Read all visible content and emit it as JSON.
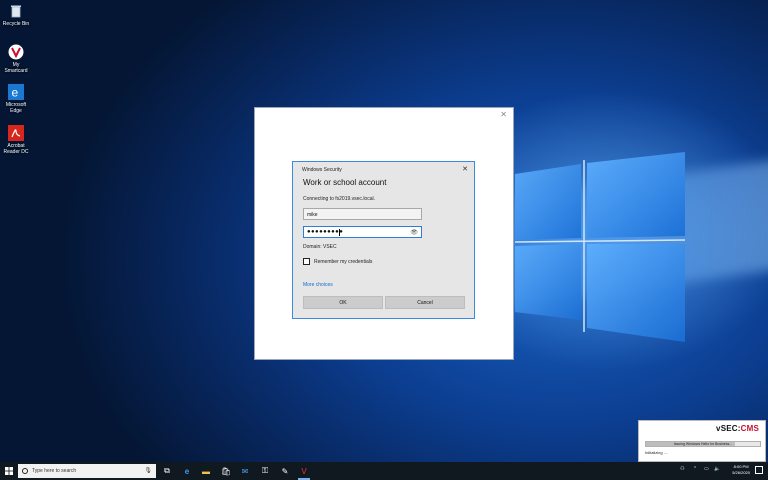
{
  "desktop": {
    "icons": [
      {
        "label": "Recycle Bin"
      },
      {
        "label": "My Smartcard"
      },
      {
        "label": "Microsoft Edge"
      },
      {
        "label": "Acrobat Reader DC"
      }
    ]
  },
  "security_dialog": {
    "title": "Windows Security",
    "heading": "Work or school account",
    "connecting_text": "Connecting to fs2019.vsec.local.",
    "username_value": "mike",
    "password_dots": "●●●●●●●●●",
    "domain_text": "Domain: VSEC",
    "remember_label": "Remember my credentials",
    "remember_checked": false,
    "more_choices": "More choices",
    "ok_label": "OK",
    "cancel_label": "Cancel"
  },
  "toast": {
    "brand_main": "vSEC:",
    "brand_accent": "CMS",
    "progress_text": "Issuing Windows Hello for Business...",
    "status": "Initializing ....",
    "accent_color": "#c8102e"
  },
  "taskbar": {
    "search_placeholder": "Type here to search",
    "clock_time": "8:00 PM",
    "clock_date": "5/26/2020"
  }
}
